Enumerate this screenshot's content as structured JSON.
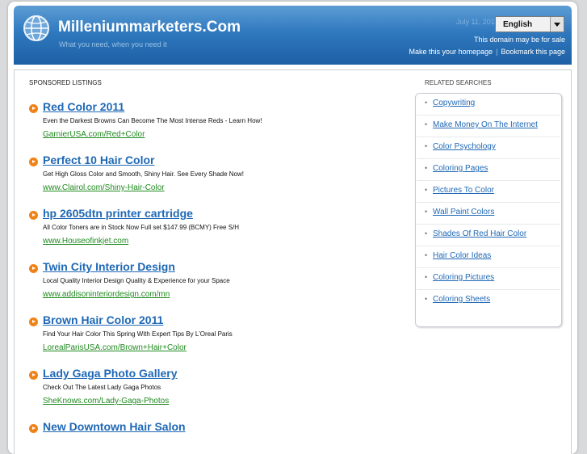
{
  "header": {
    "site_title": "Milleniummarketers.Com",
    "tagline": "What you need, when you need it",
    "date": "July 11, 2011",
    "date_separator": "|",
    "language_selected": "English",
    "sale_notice": "This domain may be for sale",
    "homepage_link": "Make this your homepage",
    "link_separator": "|",
    "bookmark_link": "Bookmark this page",
    "logo_icon": "globe-icon"
  },
  "sponsored": {
    "heading": "SPONSORED LISTINGS",
    "bullet_icon": "orange-arrow-bullet-icon",
    "listings": [
      {
        "title": "Red Color 2011",
        "description": "Even the Darkest Browns Can Become The Most Intense Reds - Learn How!",
        "url": "GarnierUSA.com/Red+Color"
      },
      {
        "title": "Perfect 10 Hair Color",
        "description": "Get High Gloss Color and Smooth, Shiny Hair. See Every Shade Now!",
        "url": "www.Clairol.com/Shiny-Hair-Color"
      },
      {
        "title": "hp 2605dtn printer cartridge",
        "description": "All Color Toners are in Stock Now Full set $147.99 (BCMY) Free S/H",
        "url": "www.Houseofinkjet.com"
      },
      {
        "title": "Twin City Interior Design",
        "description": "Local Quality Interior Design Quality & Experience for your Space",
        "url": "www.addisoninteriordesign.com/mn"
      },
      {
        "title": "Brown Hair Color 2011",
        "description": "Find Your Hair Color This Spring With Expert Tips By L'Oreal Paris",
        "url": "LorealParisUSA.com/Brown+Hair+Color"
      },
      {
        "title": "Lady Gaga Photo Gallery",
        "description": "Check Out The Latest Lady Gaga Photos",
        "url": "SheKnows.com/Lady-Gaga-Photos"
      },
      {
        "title": "New Downtown Hair Salon",
        "description": "",
        "url": ""
      }
    ]
  },
  "related": {
    "heading": "RELATED SEARCHES",
    "bullet": "•",
    "items": [
      "Copywriting",
      "Make Money On The Internet",
      "Color Psychology",
      "Coloring Pages",
      "Pictures To Color",
      "Wall Paint Colors",
      "Shades Of Red Hair Color",
      "Hair Color Ideas",
      "Coloring Pictures",
      "Coloring Sheets"
    ]
  },
  "colors": {
    "header_blue": "#2f79bf",
    "link_blue": "#1f68b5",
    "url_green": "#208a20",
    "bullet_orange": "#f08318"
  }
}
